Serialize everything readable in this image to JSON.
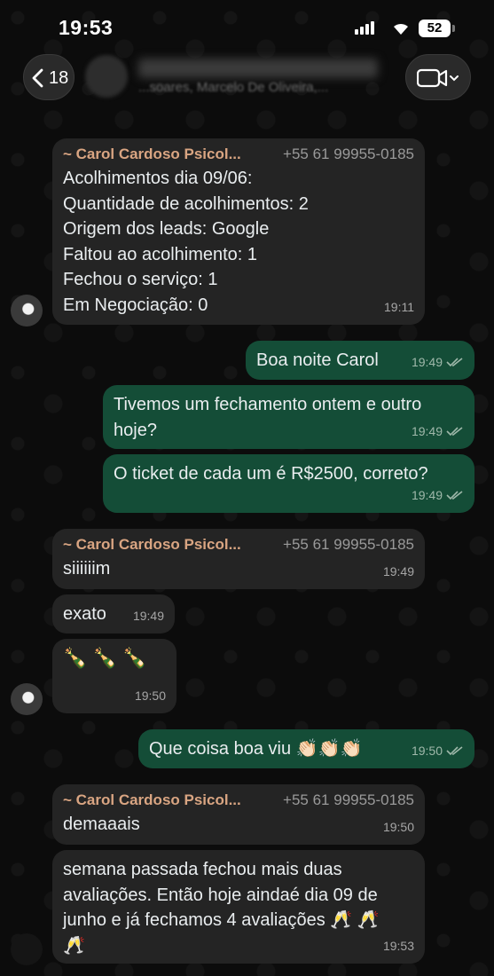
{
  "status_bar": {
    "time": "19:53",
    "battery": "52"
  },
  "header": {
    "back_count": "18",
    "subtitle": "...soares, Marcelo De Oliveira,..."
  },
  "messages": [
    {
      "direction": "in",
      "sender": "~ Carol Cardoso Psicol...",
      "phone": "+55 61 99955-0185",
      "lines": [
        "Acolhimentos dia 09/06:",
        "Quantidade de acolhimentos: 2",
        "Origem dos leads: Google",
        "Faltou ao acolhimento: 1",
        "Fechou o serviço: 1",
        "Em Negociação: 0"
      ],
      "time": "19:11"
    },
    {
      "direction": "out",
      "text": "Boa noite Carol",
      "time": "19:49"
    },
    {
      "direction": "out",
      "lines": [
        "Tivemos um fechamento ontem e outro",
        "hoje?"
      ],
      "time": "19:49"
    },
    {
      "direction": "out",
      "text": "O ticket de cada um é R$2500, correto?",
      "time": "19:49"
    },
    {
      "direction": "in",
      "sender": "~ Carol Cardoso Psicol...",
      "phone": "+55 61 99955-0185",
      "text": "siiiiiim",
      "time": "19:49"
    },
    {
      "direction": "in",
      "text": "exato",
      "time": "19:49"
    },
    {
      "direction": "in",
      "text": "🍾 🍾 🍾",
      "time": "19:50"
    },
    {
      "direction": "out",
      "text": "Que coisa boa viu 👏🏻👏🏻👏🏻",
      "time": "19:50"
    },
    {
      "direction": "in",
      "sender": "~ Carol Cardoso Psicol...",
      "phone": "+55 61 99955-0185",
      "text": "demaaais",
      "time": "19:50"
    },
    {
      "direction": "in",
      "lines": [
        "semana passada fechou mais duas",
        "avaliações. Então hoje aindaé dia 09 de",
        "junho e já fechamos 4 avaliações 🥂 🥂",
        "🥂"
      ],
      "time": "19:53"
    }
  ]
}
